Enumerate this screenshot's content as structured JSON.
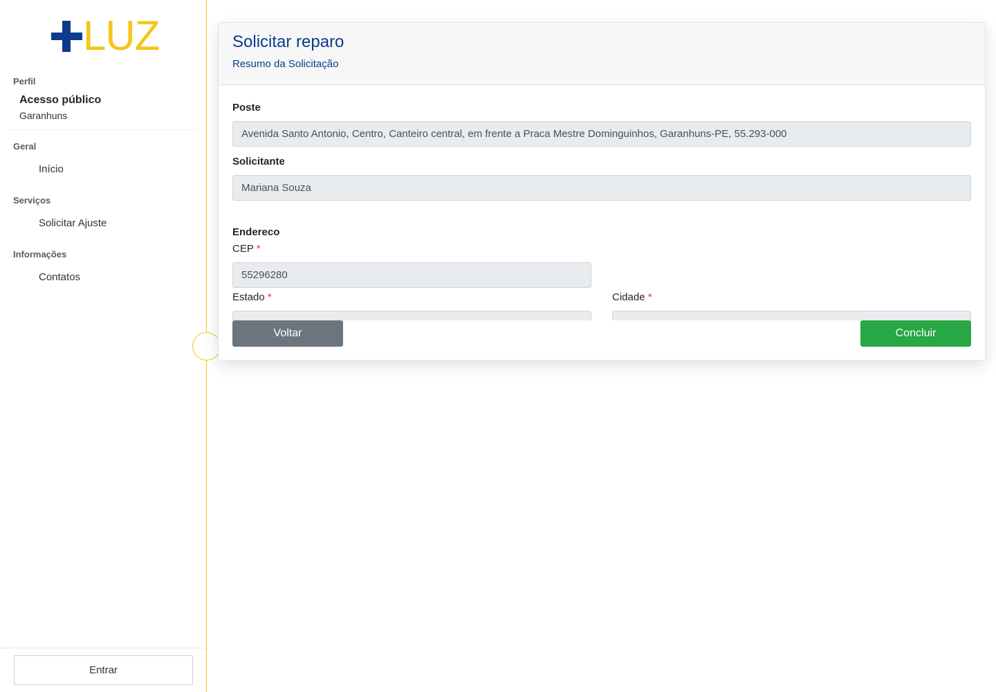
{
  "brand": {
    "logo_text": "LUZ",
    "blue": "#0c3b8c",
    "yellow": "#f5c518"
  },
  "sidebar": {
    "profile_label": "Perfil",
    "profile_name": "Acesso público",
    "profile_city": "Garanhuns",
    "sections": [
      {
        "label": "Geral",
        "items": [
          {
            "label": "Início"
          }
        ]
      },
      {
        "label": "Serviços",
        "items": [
          {
            "label": "Solicitar Ajuste"
          }
        ]
      },
      {
        "label": "Informações",
        "items": [
          {
            "label": "Contatos"
          }
        ]
      }
    ],
    "login_button": "Entrar"
  },
  "card": {
    "title": "Solicitar reparo",
    "subtitle": "Resumo da Solicitação",
    "poste_label": "Poste",
    "poste_value": "Avenida Santo Antonio, Centro, Canteiro central, em frente a Praca Mestre Dominguinhos, Garanhuns-PE, 55.293-000",
    "solicitante_label": "Solicitante",
    "solicitante_value": "Mariana Souza",
    "endereco_label": "Endereco",
    "cep_label": "CEP",
    "cep_value": "55296280",
    "estado_label": "Estado",
    "cidade_label": "Cidade",
    "required_mark": "*",
    "back_button": "Voltar",
    "finish_button": "Concluir"
  },
  "colors": {
    "success": "#28a745",
    "secondary": "#6c757d",
    "required": "#dc3545"
  }
}
